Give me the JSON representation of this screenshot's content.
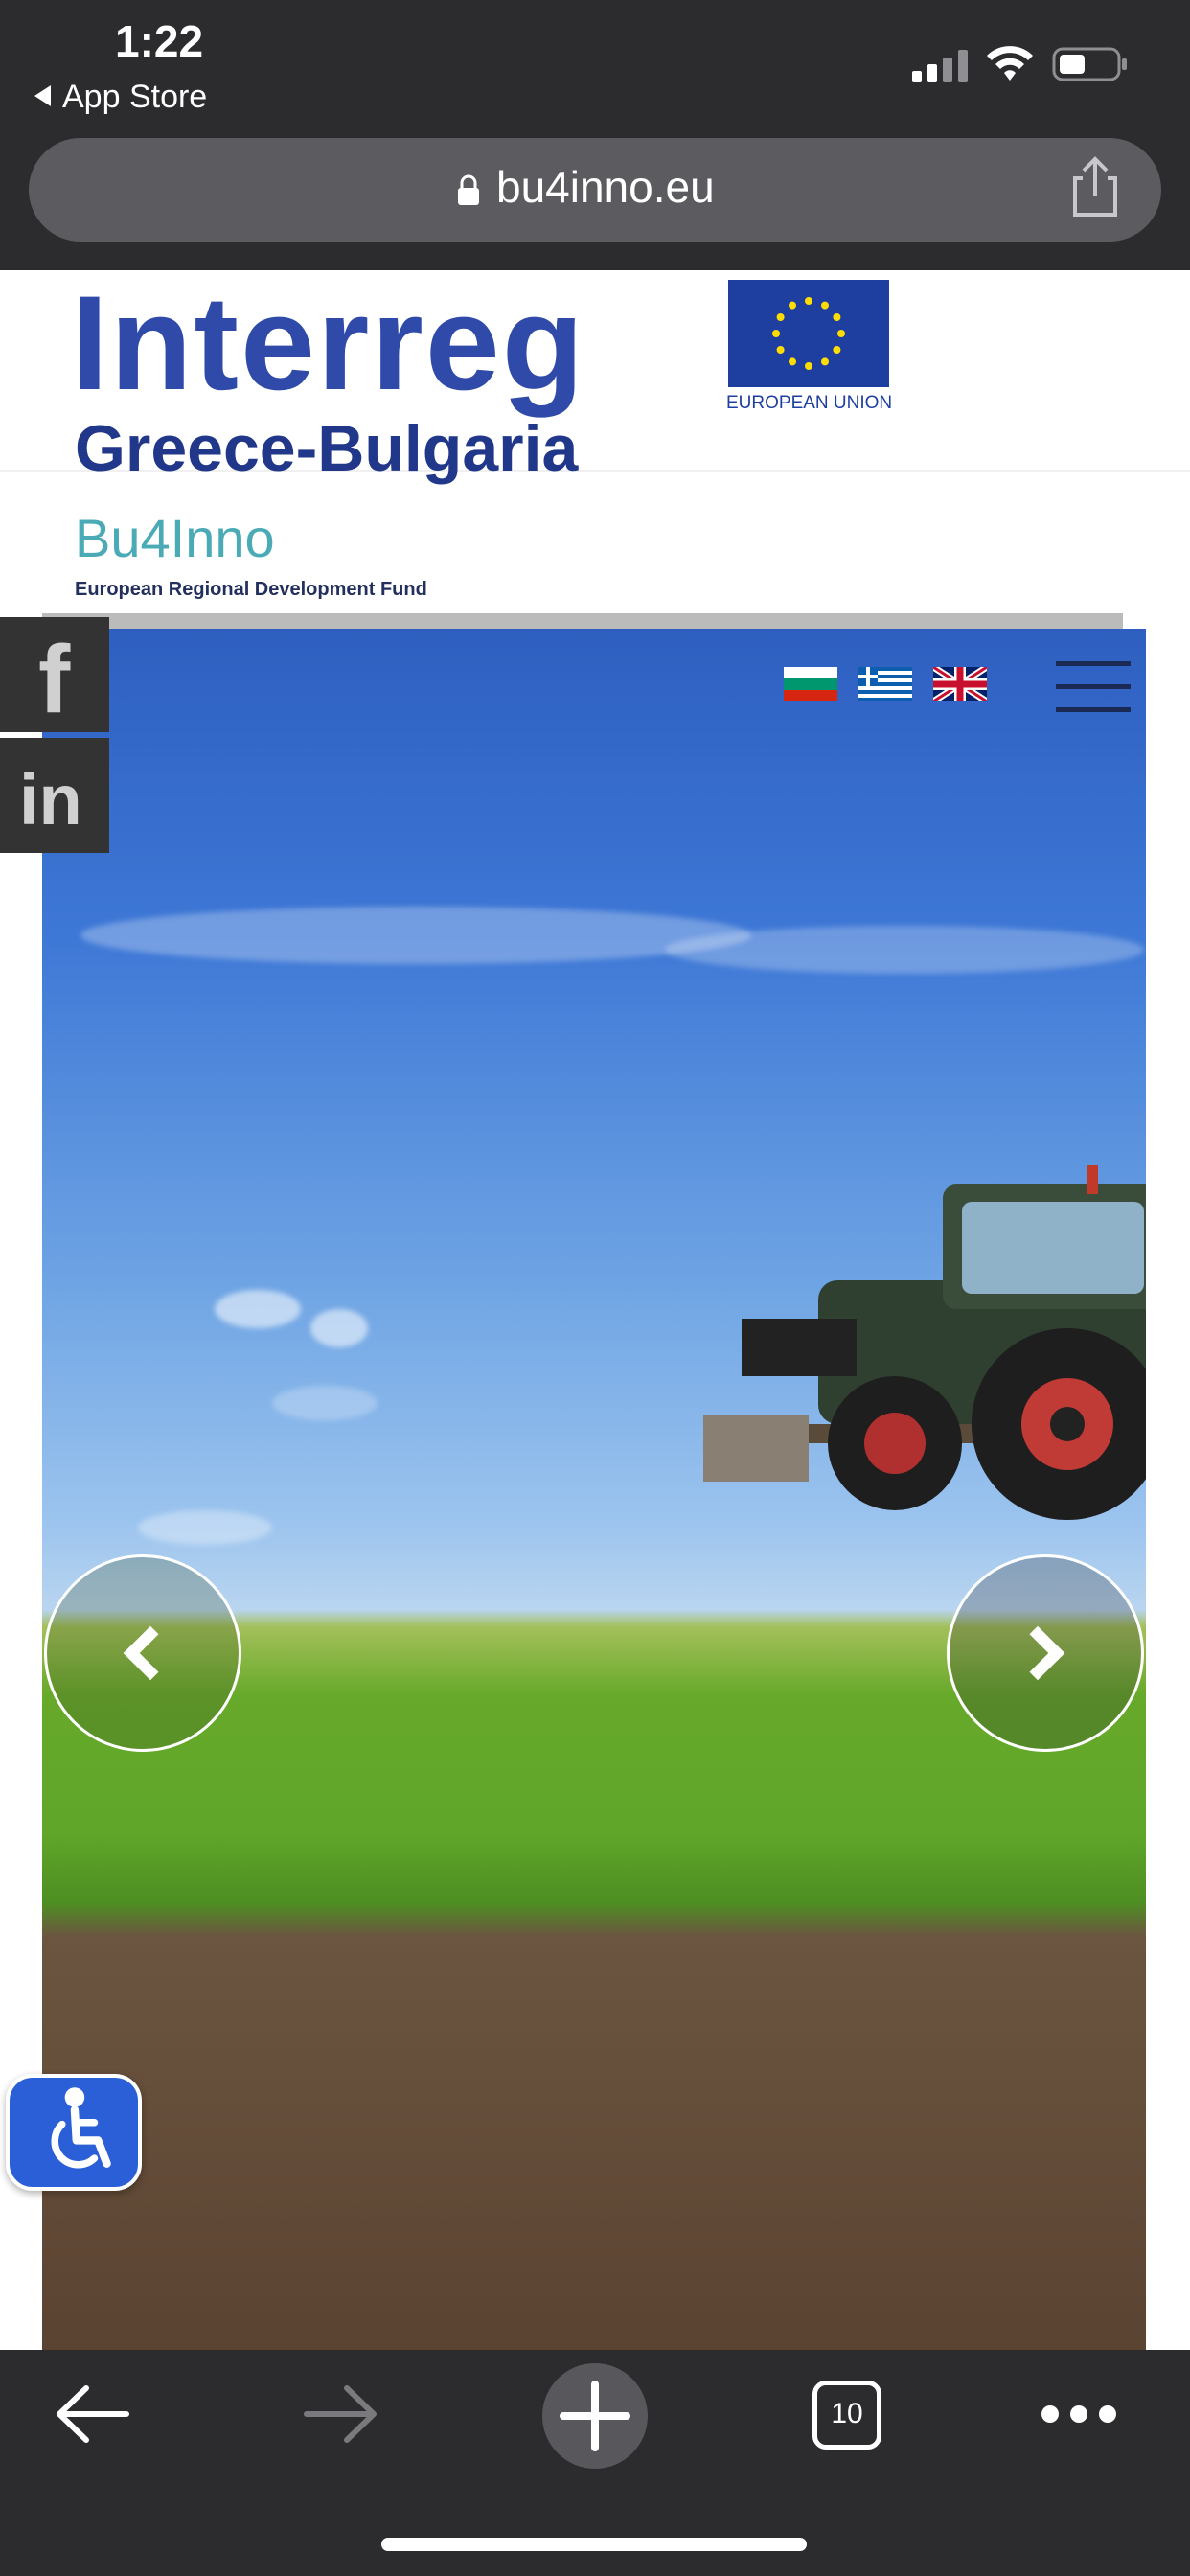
{
  "status_bar": {
    "time": "1:22",
    "back_app": "App Store",
    "icons": [
      "cellular-signal-icon",
      "wifi-icon",
      "battery-icon"
    ]
  },
  "browser": {
    "url": "bu4inno.eu",
    "tabs_count": "10",
    "icons": [
      "lock-icon",
      "share-icon",
      "back-arrow-icon",
      "forward-arrow-icon",
      "plus-icon",
      "tabs-icon",
      "more-dots-icon"
    ]
  },
  "site": {
    "logo": {
      "program": "Interreg",
      "region": "Greece-Bulgaria",
      "project": "Bu4Inno",
      "fund": "European Regional Development Fund",
      "eu_label": "EUROPEAN UNION"
    },
    "languages": [
      "bg-flag-icon",
      "gr-flag-icon",
      "uk-flag-icon"
    ],
    "social": {
      "facebook_label": "f",
      "linkedin_label": "in"
    },
    "slider": {
      "image": "tractor-field-photo"
    },
    "colors": {
      "interreg_blue": "#2f4aa8",
      "project_teal": "#4aabb6",
      "eu_blue": "#1f3fa0",
      "eu_star": "#ffdd00",
      "access_blue": "#2b5fd8"
    }
  }
}
